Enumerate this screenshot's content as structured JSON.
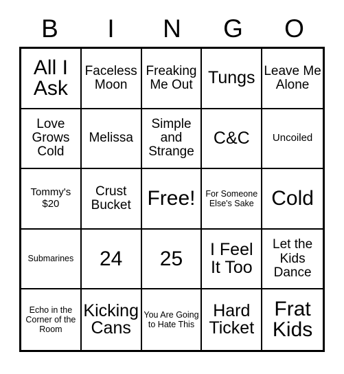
{
  "card": {
    "header_letters": [
      "B",
      "I",
      "N",
      "G",
      "O"
    ],
    "rows": [
      [
        {
          "text": "All I Ask",
          "size": "xl"
        },
        {
          "text": "Faceless Moon",
          "size": "md"
        },
        {
          "text": "Freaking Me Out",
          "size": "md"
        },
        {
          "text": "Tungs",
          "size": "lg"
        },
        {
          "text": "Leave Me Alone",
          "size": "md"
        }
      ],
      [
        {
          "text": "Love Grows Cold",
          "size": "md"
        },
        {
          "text": "Melissa",
          "size": "md"
        },
        {
          "text": "Simple and Strange",
          "size": "md"
        },
        {
          "text": "C&C",
          "size": "lg"
        },
        {
          "text": "Uncoiled",
          "size": "sm"
        }
      ],
      [
        {
          "text": "Tommy's $20",
          "size": "sm"
        },
        {
          "text": "Crust Bucket",
          "size": "md"
        },
        {
          "text": "Free!",
          "size": "xl"
        },
        {
          "text": "For Someone Else's Sake",
          "size": "xs"
        },
        {
          "text": "Cold",
          "size": "xl"
        }
      ],
      [
        {
          "text": "Submarines",
          "size": "xs"
        },
        {
          "text": "24",
          "size": "xl"
        },
        {
          "text": "25",
          "size": "xl"
        },
        {
          "text": "I Feel It Too",
          "size": "lg"
        },
        {
          "text": "Let the Kids Dance",
          "size": "md"
        }
      ],
      [
        {
          "text": "Echo in the Corner of the Room",
          "size": "xs"
        },
        {
          "text": "Kicking Cans",
          "size": "lg"
        },
        {
          "text": "You Are Going to Hate This",
          "size": "xs"
        },
        {
          "text": "Hard Ticket",
          "size": "lg"
        },
        {
          "text": "Frat Kids",
          "size": "xl"
        }
      ]
    ]
  }
}
